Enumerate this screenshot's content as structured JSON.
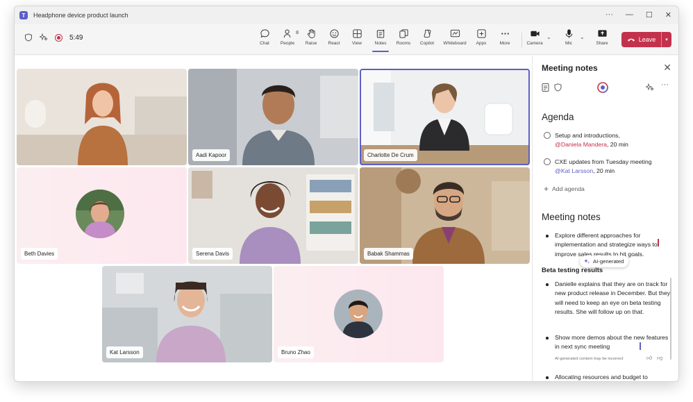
{
  "window": {
    "title": "Headphone device product launch"
  },
  "window_controls": {
    "more": "···",
    "minimize": "—",
    "maximize": "☐",
    "close": "✕"
  },
  "meeting": {
    "timer": "5:49"
  },
  "toolbar": {
    "people_count": "8",
    "items": [
      {
        "label": "Chat",
        "icon": "chat-icon"
      },
      {
        "label": "People",
        "icon": "people-icon"
      },
      {
        "label": "Raise",
        "icon": "raise-hand-icon"
      },
      {
        "label": "React",
        "icon": "react-icon"
      },
      {
        "label": "View",
        "icon": "view-icon"
      },
      {
        "label": "Notes",
        "icon": "notes-icon",
        "active": true
      },
      {
        "label": "Rooms",
        "icon": "rooms-icon"
      },
      {
        "label": "Copilot",
        "icon": "copilot-icon"
      },
      {
        "label": "Whiteboard",
        "icon": "whiteboard-icon"
      },
      {
        "label": "Apps",
        "icon": "apps-icon"
      },
      {
        "label": "More",
        "icon": "more-icon"
      },
      {
        "label": "Camera",
        "icon": "camera-icon"
      },
      {
        "label": "Mic",
        "icon": "mic-icon"
      },
      {
        "label": "Share",
        "icon": "share-icon"
      }
    ],
    "leave_label": "Leave",
    "accent": "#5b5fc7",
    "leave_color": "#c4314b"
  },
  "participants": [
    {
      "name": ""
    },
    {
      "name": "Aadi Kapoor"
    },
    {
      "name": "Charlotte De Crum",
      "speaking": true
    },
    {
      "name": "Beth Davies"
    },
    {
      "name": "Serena Davis"
    },
    {
      "name": "Babak Shammas"
    },
    {
      "name": "Kat Larsson"
    },
    {
      "name": "Bruno Zhao"
    }
  ],
  "notes_panel": {
    "title": "Meeting notes",
    "agenda_heading": "Agenda",
    "agenda_items": [
      {
        "text": "Setup and introductions,",
        "mention": "@Daniela Mandera",
        "duration": ", 20 min"
      },
      {
        "text": "CXE updates from Tuesday meeting",
        "mention": "@Kat Larsson",
        "duration": ", 20 min"
      }
    ],
    "add_agenda": "Add agenda",
    "notes_heading": "Meeting notes",
    "notes": [
      "Explore different approaches for implementation and strategize ways to improve sales results to hit goals."
    ],
    "ai_tag": "AI-generated",
    "ai_section_title": "Beta testing results",
    "ai_notes": [
      "Danielle explains that they are on track for new product release in December. But they will need to keep an eye on beta testing results. She will follow up on that.",
      "Show more demos about the new features in next sync meeting"
    ],
    "ai_disclaimer": "AI-generated content may be incorrect",
    "more_notes": [
      "Allocating resources and budget to different marketing initiatives based on"
    ]
  }
}
